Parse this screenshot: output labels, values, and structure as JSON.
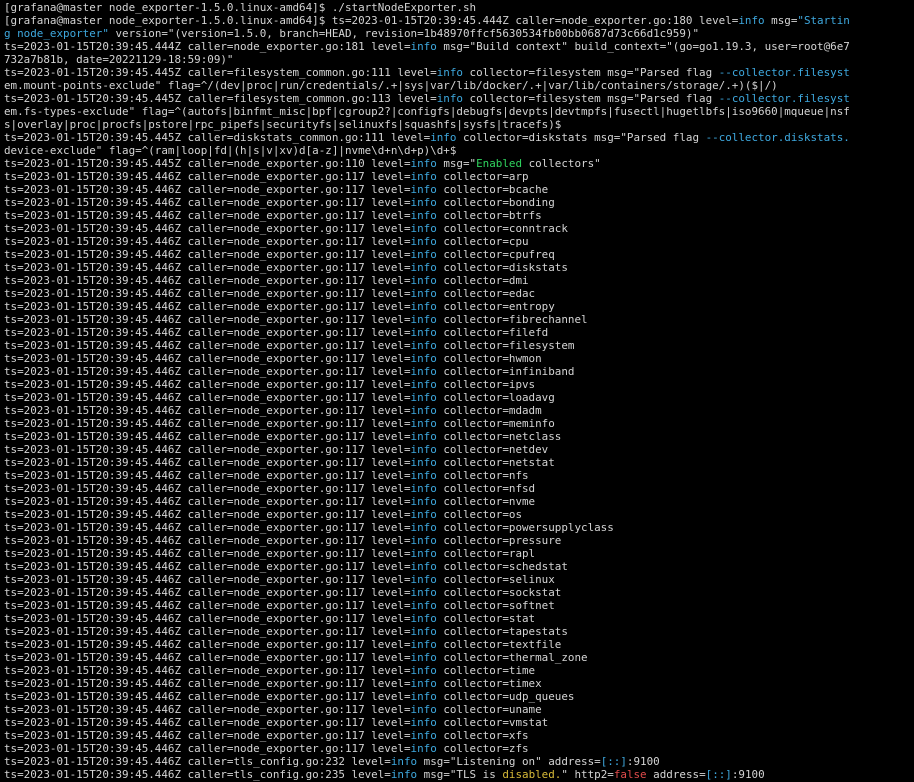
{
  "colors": {
    "background": "#000000",
    "text": "#d4d4d4",
    "info": "#3ea8de",
    "enabled": "#2fd35e",
    "disabled": "#d7ba38",
    "false": "#e04b4b"
  },
  "lines": [
    [
      {
        "t": "[grafana@master node_exporter-1.5.0.linux-amd64]$ ./startNodeExporter.sh"
      }
    ],
    [
      {
        "t": "[grafana@master node_exporter-1.5.0.linux-amd64]$ ts=2023-01-15T20:39:45.444Z caller=node_exporter.go:180 level="
      },
      {
        "t": "info",
        "c": "info"
      },
      {
        "t": " msg="
      },
      {
        "t": "\"Startin",
        "c": "hl"
      }
    ],
    [
      {
        "t": "g node_exporter\"",
        "c": "hl"
      },
      {
        "t": " version=\"(version=1.5.0, branch=HEAD, revision=1b48970ffcf5630534fb00bb0687d73c66d1c959)\""
      }
    ],
    [
      {
        "t": "ts=2023-01-15T20:39:45.444Z caller=node_exporter.go:181 level="
      },
      {
        "t": "info",
        "c": "info"
      },
      {
        "t": " msg=\"Build context\" build_context=\"(go=go1.19.3, user=root@6e7"
      }
    ],
    [
      {
        "t": "732a7b81b, date=20221129-18:59:09)\""
      }
    ],
    [
      {
        "t": "ts=2023-01-15T20:39:45.445Z caller=filesystem_common.go:111 level="
      },
      {
        "t": "info",
        "c": "info"
      },
      {
        "t": " collector=filesystem msg=\"Parsed flag "
      },
      {
        "t": "--collector.filesyst",
        "c": "hl"
      }
    ],
    [
      {
        "t": "em.mount-points-exclude\" flag=^/(dev|proc|run/credentials/.+|sys|var/lib/docker/.+|var/lib/containers/storage/.+)($|/)"
      }
    ],
    [
      {
        "t": "ts=2023-01-15T20:39:45.445Z caller=filesystem_common.go:113 level="
      },
      {
        "t": "info",
        "c": "info"
      },
      {
        "t": " collector=filesystem msg=\"Parsed flag "
      },
      {
        "t": "--collector.filesyst",
        "c": "hl"
      }
    ],
    [
      {
        "t": "em.fs-types-exclude\" flag=^(autofs|binfmt_misc|bpf|cgroup2?|configfs|debugfs|devpts|devtmpfs|fusectl|hugetlbfs|iso9660|mqueue|nsf"
      }
    ],
    [
      {
        "t": "s|overlay|proc|procfs|pstore|rpc_pipefs|securityfs|selinuxfs|squashfs|sysfs|tracefs)$"
      }
    ],
    [
      {
        "t": "ts=2023-01-15T20:39:45.445Z caller=diskstats_common.go:111 level="
      },
      {
        "t": "info",
        "c": "info"
      },
      {
        "t": " collector=diskstats msg=\"Parsed flag "
      },
      {
        "t": "--collector.diskstats.",
        "c": "hl"
      }
    ],
    [
      {
        "t": "device-exclude\" flag=^(ram|loop|fd|(h|s|v|xv)d[a-z]|nvme\\d+n\\d+p)\\d+$"
      }
    ],
    [
      {
        "t": "ts=2023-01-15T20:39:45.445Z caller=node_exporter.go:110 level="
      },
      {
        "t": "info",
        "c": "info"
      },
      {
        "t": " msg=\""
      },
      {
        "t": "Enabled",
        "c": "green"
      },
      {
        "t": " collectors\""
      }
    ],
    [
      {
        "t": "ts=2023-01-15T20:39:45.446Z caller=node_exporter.go:117 level="
      },
      {
        "t": "info",
        "c": "info"
      },
      {
        "t": " collector=arp"
      }
    ],
    [
      {
        "t": "ts=2023-01-15T20:39:45.446Z caller=node_exporter.go:117 level="
      },
      {
        "t": "info",
        "c": "info"
      },
      {
        "t": " collector=bcache"
      }
    ],
    [
      {
        "t": "ts=2023-01-15T20:39:45.446Z caller=node_exporter.go:117 level="
      },
      {
        "t": "info",
        "c": "info"
      },
      {
        "t": " collector=bonding"
      }
    ],
    [
      {
        "t": "ts=2023-01-15T20:39:45.446Z caller=node_exporter.go:117 level="
      },
      {
        "t": "info",
        "c": "info"
      },
      {
        "t": " collector=btrfs"
      }
    ],
    [
      {
        "t": "ts=2023-01-15T20:39:45.446Z caller=node_exporter.go:117 level="
      },
      {
        "t": "info",
        "c": "info"
      },
      {
        "t": " collector=conntrack"
      }
    ],
    [
      {
        "t": "ts=2023-01-15T20:39:45.446Z caller=node_exporter.go:117 level="
      },
      {
        "t": "info",
        "c": "info"
      },
      {
        "t": " collector=cpu"
      }
    ],
    [
      {
        "t": "ts=2023-01-15T20:39:45.446Z caller=node_exporter.go:117 level="
      },
      {
        "t": "info",
        "c": "info"
      },
      {
        "t": " collector=cpufreq"
      }
    ],
    [
      {
        "t": "ts=2023-01-15T20:39:45.446Z caller=node_exporter.go:117 level="
      },
      {
        "t": "info",
        "c": "info"
      },
      {
        "t": " collector=diskstats"
      }
    ],
    [
      {
        "t": "ts=2023-01-15T20:39:45.446Z caller=node_exporter.go:117 level="
      },
      {
        "t": "info",
        "c": "info"
      },
      {
        "t": " collector=dmi"
      }
    ],
    [
      {
        "t": "ts=2023-01-15T20:39:45.446Z caller=node_exporter.go:117 level="
      },
      {
        "t": "info",
        "c": "info"
      },
      {
        "t": " collector=edac"
      }
    ],
    [
      {
        "t": "ts=2023-01-15T20:39:45.446Z caller=node_exporter.go:117 level="
      },
      {
        "t": "info",
        "c": "info"
      },
      {
        "t": " collector=entropy"
      }
    ],
    [
      {
        "t": "ts=2023-01-15T20:39:45.446Z caller=node_exporter.go:117 level="
      },
      {
        "t": "info",
        "c": "info"
      },
      {
        "t": " collector=fibrechannel"
      }
    ],
    [
      {
        "t": "ts=2023-01-15T20:39:45.446Z caller=node_exporter.go:117 level="
      },
      {
        "t": "info",
        "c": "info"
      },
      {
        "t": " collector=filefd"
      }
    ],
    [
      {
        "t": "ts=2023-01-15T20:39:45.446Z caller=node_exporter.go:117 level="
      },
      {
        "t": "info",
        "c": "info"
      },
      {
        "t": " collector=filesystem"
      }
    ],
    [
      {
        "t": "ts=2023-01-15T20:39:45.446Z caller=node_exporter.go:117 level="
      },
      {
        "t": "info",
        "c": "info"
      },
      {
        "t": " collector=hwmon"
      }
    ],
    [
      {
        "t": "ts=2023-01-15T20:39:45.446Z caller=node_exporter.go:117 level="
      },
      {
        "t": "info",
        "c": "info"
      },
      {
        "t": " collector=infiniband"
      }
    ],
    [
      {
        "t": "ts=2023-01-15T20:39:45.446Z caller=node_exporter.go:117 level="
      },
      {
        "t": "info",
        "c": "info"
      },
      {
        "t": " collector=ipvs"
      }
    ],
    [
      {
        "t": "ts=2023-01-15T20:39:45.446Z caller=node_exporter.go:117 level="
      },
      {
        "t": "info",
        "c": "info"
      },
      {
        "t": " collector=loadavg"
      }
    ],
    [
      {
        "t": "ts=2023-01-15T20:39:45.446Z caller=node_exporter.go:117 level="
      },
      {
        "t": "info",
        "c": "info"
      },
      {
        "t": " collector=mdadm"
      }
    ],
    [
      {
        "t": "ts=2023-01-15T20:39:45.446Z caller=node_exporter.go:117 level="
      },
      {
        "t": "info",
        "c": "info"
      },
      {
        "t": " collector=meminfo"
      }
    ],
    [
      {
        "t": "ts=2023-01-15T20:39:45.446Z caller=node_exporter.go:117 level="
      },
      {
        "t": "info",
        "c": "info"
      },
      {
        "t": " collector=netclass"
      }
    ],
    [
      {
        "t": "ts=2023-01-15T20:39:45.446Z caller=node_exporter.go:117 level="
      },
      {
        "t": "info",
        "c": "info"
      },
      {
        "t": " collector=netdev"
      }
    ],
    [
      {
        "t": "ts=2023-01-15T20:39:45.446Z caller=node_exporter.go:117 level="
      },
      {
        "t": "info",
        "c": "info"
      },
      {
        "t": " collector=netstat"
      }
    ],
    [
      {
        "t": "ts=2023-01-15T20:39:45.446Z caller=node_exporter.go:117 level="
      },
      {
        "t": "info",
        "c": "info"
      },
      {
        "t": " collector=nfs"
      }
    ],
    [
      {
        "t": "ts=2023-01-15T20:39:45.446Z caller=node_exporter.go:117 level="
      },
      {
        "t": "info",
        "c": "info"
      },
      {
        "t": " collector=nfsd"
      }
    ],
    [
      {
        "t": "ts=2023-01-15T20:39:45.446Z caller=node_exporter.go:117 level="
      },
      {
        "t": "info",
        "c": "info"
      },
      {
        "t": " collector=nvme"
      }
    ],
    [
      {
        "t": "ts=2023-01-15T20:39:45.446Z caller=node_exporter.go:117 level="
      },
      {
        "t": "info",
        "c": "info"
      },
      {
        "t": " collector=os"
      }
    ],
    [
      {
        "t": "ts=2023-01-15T20:39:45.446Z caller=node_exporter.go:117 level="
      },
      {
        "t": "info",
        "c": "info"
      },
      {
        "t": " collector=powersupplyclass"
      }
    ],
    [
      {
        "t": "ts=2023-01-15T20:39:45.446Z caller=node_exporter.go:117 level="
      },
      {
        "t": "info",
        "c": "info"
      },
      {
        "t": " collector=pressure"
      }
    ],
    [
      {
        "t": "ts=2023-01-15T20:39:45.446Z caller=node_exporter.go:117 level="
      },
      {
        "t": "info",
        "c": "info"
      },
      {
        "t": " collector=rapl"
      }
    ],
    [
      {
        "t": "ts=2023-01-15T20:39:45.446Z caller=node_exporter.go:117 level="
      },
      {
        "t": "info",
        "c": "info"
      },
      {
        "t": " collector=schedstat"
      }
    ],
    [
      {
        "t": "ts=2023-01-15T20:39:45.446Z caller=node_exporter.go:117 level="
      },
      {
        "t": "info",
        "c": "info"
      },
      {
        "t": " collector=selinux"
      }
    ],
    [
      {
        "t": "ts=2023-01-15T20:39:45.446Z caller=node_exporter.go:117 level="
      },
      {
        "t": "info",
        "c": "info"
      },
      {
        "t": " collector=sockstat"
      }
    ],
    [
      {
        "t": "ts=2023-01-15T20:39:45.446Z caller=node_exporter.go:117 level="
      },
      {
        "t": "info",
        "c": "info"
      },
      {
        "t": " collector=softnet"
      }
    ],
    [
      {
        "t": "ts=2023-01-15T20:39:45.446Z caller=node_exporter.go:117 level="
      },
      {
        "t": "info",
        "c": "info"
      },
      {
        "t": " collector=stat"
      }
    ],
    [
      {
        "t": "ts=2023-01-15T20:39:45.446Z caller=node_exporter.go:117 level="
      },
      {
        "t": "info",
        "c": "info"
      },
      {
        "t": " collector=tapestats"
      }
    ],
    [
      {
        "t": "ts=2023-01-15T20:39:45.446Z caller=node_exporter.go:117 level="
      },
      {
        "t": "info",
        "c": "info"
      },
      {
        "t": " collector=textfile"
      }
    ],
    [
      {
        "t": "ts=2023-01-15T20:39:45.446Z caller=node_exporter.go:117 level="
      },
      {
        "t": "info",
        "c": "info"
      },
      {
        "t": " collector=thermal_zone"
      }
    ],
    [
      {
        "t": "ts=2023-01-15T20:39:45.446Z caller=node_exporter.go:117 level="
      },
      {
        "t": "info",
        "c": "info"
      },
      {
        "t": " collector=time"
      }
    ],
    [
      {
        "t": "ts=2023-01-15T20:39:45.446Z caller=node_exporter.go:117 level="
      },
      {
        "t": "info",
        "c": "info"
      },
      {
        "t": " collector=timex"
      }
    ],
    [
      {
        "t": "ts=2023-01-15T20:39:45.446Z caller=node_exporter.go:117 level="
      },
      {
        "t": "info",
        "c": "info"
      },
      {
        "t": " collector=udp_queues"
      }
    ],
    [
      {
        "t": "ts=2023-01-15T20:39:45.446Z caller=node_exporter.go:117 level="
      },
      {
        "t": "info",
        "c": "info"
      },
      {
        "t": " collector=uname"
      }
    ],
    [
      {
        "t": "ts=2023-01-15T20:39:45.446Z caller=node_exporter.go:117 level="
      },
      {
        "t": "info",
        "c": "info"
      },
      {
        "t": " collector=vmstat"
      }
    ],
    [
      {
        "t": "ts=2023-01-15T20:39:45.446Z caller=node_exporter.go:117 level="
      },
      {
        "t": "info",
        "c": "info"
      },
      {
        "t": " collector=xfs"
      }
    ],
    [
      {
        "t": "ts=2023-01-15T20:39:45.446Z caller=node_exporter.go:117 level="
      },
      {
        "t": "info",
        "c": "info"
      },
      {
        "t": " collector=zfs"
      }
    ],
    [
      {
        "t": "ts=2023-01-15T20:39:45.446Z caller=tls_config.go:232 level="
      },
      {
        "t": "info",
        "c": "info"
      },
      {
        "t": " msg=\"Listening on\" address="
      },
      {
        "t": "[::]",
        "c": "hl"
      },
      {
        "t": ":9100"
      }
    ],
    [
      {
        "t": "ts=2023-01-15T20:39:45.446Z caller=tls_config.go:235 level="
      },
      {
        "t": "info",
        "c": "info"
      },
      {
        "t": " msg=\"TLS is "
      },
      {
        "t": "disabled.",
        "c": "yellow"
      },
      {
        "t": "\" http2="
      },
      {
        "t": "false",
        "c": "red"
      },
      {
        "t": " address="
      },
      {
        "t": "[::]",
        "c": "hl"
      },
      {
        "t": ":9100"
      }
    ]
  ]
}
